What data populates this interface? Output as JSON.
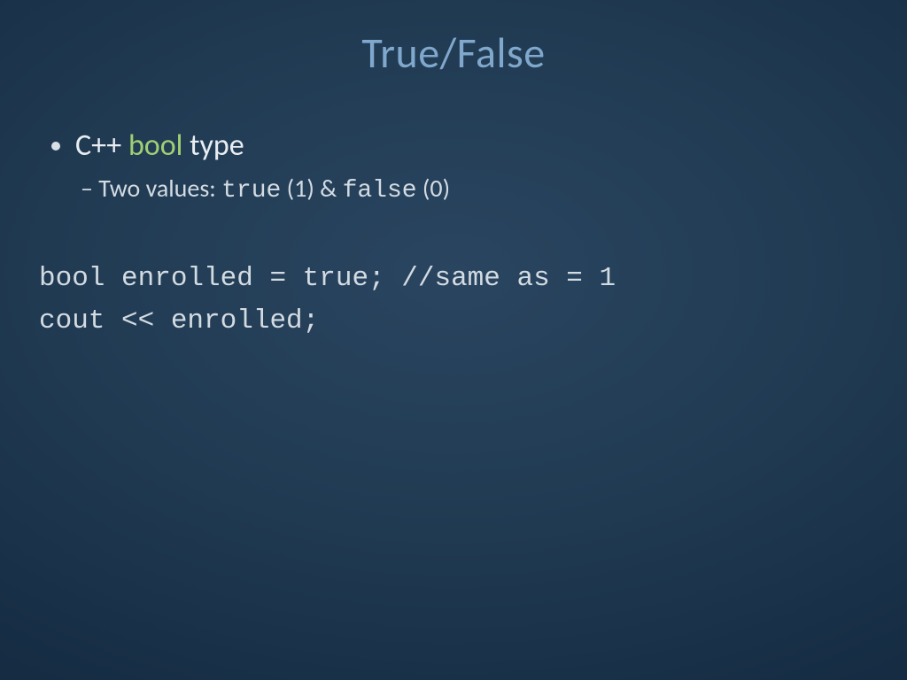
{
  "slide": {
    "title": "True/False",
    "bullet1_prefix": "C++ ",
    "bullet1_keyword": "bool",
    "bullet1_suffix": " type",
    "sub_prefix": "Two values: ",
    "sub_true": "true",
    "sub_mid": " (1) & ",
    "sub_false": "false",
    "sub_suffix": " (0)",
    "code_line1": "bool enrolled = true; //same as = 1",
    "code_line2": "cout << enrolled;"
  }
}
